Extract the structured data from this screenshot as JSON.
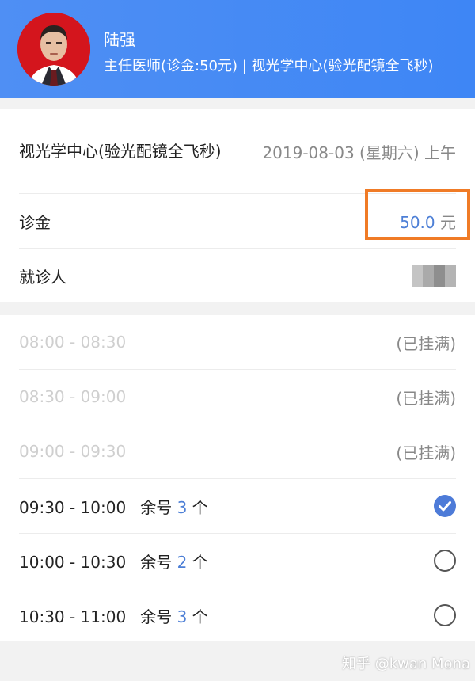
{
  "doctor": {
    "name": "陆强",
    "info": "主任医师(诊金:50元) | 视光学中心(验光配镜全飞秒)"
  },
  "appointment": {
    "department": "视光学中心(验光配镜全飞秒)",
    "date": "2019-08-03 (星期六) 上午",
    "fee_label": "诊金",
    "fee_value": "50.0",
    "fee_unit": "元",
    "patient_label": "就诊人"
  },
  "slots": [
    {
      "time": "08:00 - 08:30",
      "status": "(已挂满)"
    },
    {
      "time": "08:30 - 09:00",
      "status": "(已挂满)"
    },
    {
      "time": "09:00 - 09:30",
      "status": "(已挂满)"
    },
    {
      "time": "09:30 - 10:00",
      "remain_prefix": "余号",
      "remain_count": "3",
      "remain_suffix": "个",
      "selected": true
    },
    {
      "time": "10:00 - 10:30",
      "remain_prefix": "余号",
      "remain_count": "2",
      "remain_suffix": "个",
      "selected": false
    },
    {
      "time": "10:30 - 11:00",
      "remain_prefix": "余号",
      "remain_count": "3",
      "remain_suffix": "个",
      "selected": false
    }
  ],
  "watermark": "知乎 @kwan Mona",
  "colors": {
    "header": "#4f8ff4",
    "accent": "#4d7fd6",
    "highlight": "#f07b26"
  }
}
